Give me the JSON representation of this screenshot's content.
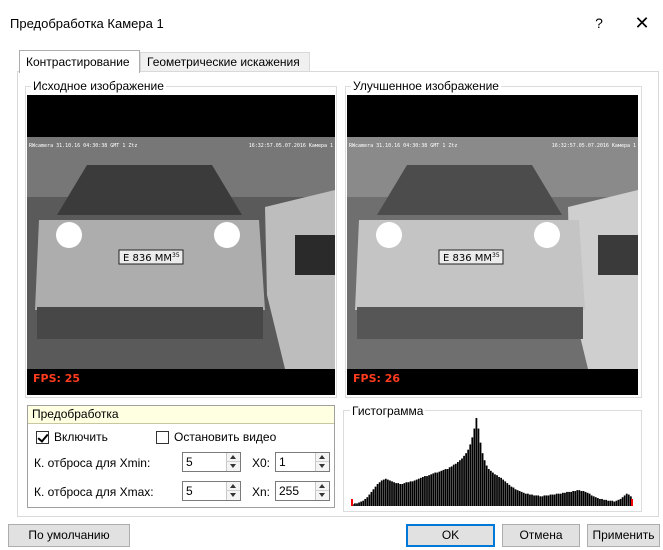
{
  "window": {
    "title": "Предобработка Камера 1",
    "help": "?",
    "close": "✕"
  },
  "tabs": [
    {
      "label": "Контрастирование",
      "active": true
    },
    {
      "label": "Геометрические искажения",
      "active": false
    }
  ],
  "source_panel": {
    "label": "Исходное изображение",
    "fps": "FPS: 25",
    "overlay_left": "RWcamera  31.10.16  04:30:38 GMT  1  Ztz",
    "overlay_right": "16:32:57.05.07.2016  Камера 1",
    "plate": "E 836 MM",
    "plate_region": "35"
  },
  "enhanced_panel": {
    "label": "Улучшенное изображение",
    "fps": "FPS: 26",
    "overlay_left": "RWcamera  31.10.16  04:30:38 GMT  1  Ztz",
    "overlay_right": "16:32:57.05.07.2016  Камера 1",
    "plate": "E 836 MM",
    "plate_region": "35"
  },
  "preprocessing": {
    "title": "Предобработка",
    "enable_label": "Включить",
    "enable_checked": true,
    "stop_video_label": "Остановить видео",
    "stop_video_checked": false,
    "xmin_label": "К. отброса для Xmin:",
    "xmin_value": "5",
    "x0_label": "X0:",
    "x0_value": "1",
    "xmax_label": "К. отброса для Xmax:",
    "xmax_value": "5",
    "xn_label": "Xn:",
    "xn_value": "255"
  },
  "histogram": {
    "label": "Гистограмма",
    "marker_color": "#ff0000",
    "bar_color": "#000000"
  },
  "chart_data": {
    "type": "bar",
    "title": "Гистограмма",
    "xlim": [
      0,
      255
    ],
    "values": [
      2,
      3,
      3,
      4,
      5,
      6,
      8,
      10,
      13,
      16,
      19,
      22,
      25,
      27,
      29,
      30,
      31,
      30,
      29,
      28,
      27,
      26,
      26,
      25,
      25,
      26,
      27,
      27,
      28,
      28,
      29,
      30,
      31,
      32,
      33,
      34,
      34,
      35,
      36,
      37,
      38,
      38,
      39,
      40,
      41,
      42,
      42,
      44,
      45,
      47,
      48,
      50,
      52,
      54,
      57,
      60,
      64,
      70,
      78,
      88,
      100,
      88,
      72,
      60,
      52,
      46,
      42,
      40,
      38,
      36,
      35,
      33,
      32,
      30,
      28,
      26,
      24,
      22,
      21,
      19,
      18,
      17,
      16,
      15,
      14,
      14,
      13,
      13,
      12,
      12,
      12,
      11,
      11,
      12,
      12,
      12,
      13,
      13,
      13,
      14,
      14,
      14,
      15,
      15,
      16,
      16,
      16,
      17,
      17,
      18,
      18,
      17,
      17,
      16,
      15,
      14,
      12,
      11,
      10,
      9,
      8,
      8,
      7,
      7,
      6,
      6,
      6,
      5,
      6,
      7,
      8,
      10,
      12,
      14,
      13,
      11
    ]
  },
  "footer": {
    "defaults_label": "По умолчанию",
    "ok_label": "OK",
    "cancel_label": "Отмена",
    "apply_label": "Применить"
  }
}
